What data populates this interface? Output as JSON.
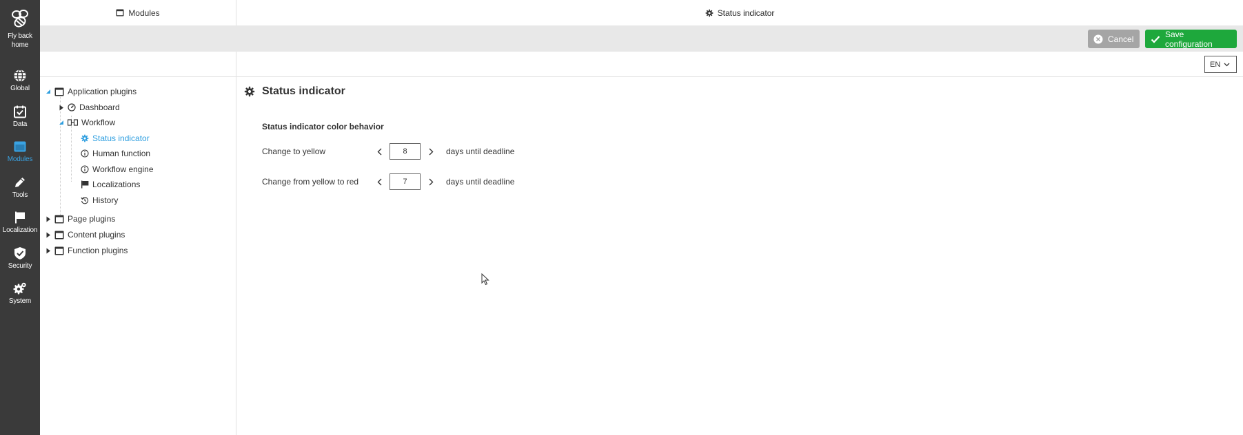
{
  "rail": {
    "home_label": "Fly back home",
    "items": [
      {
        "label": "Global",
        "icon": "globe-icon"
      },
      {
        "label": "Data",
        "icon": "calendar-check-icon"
      },
      {
        "label": "Modules",
        "icon": "window-icon",
        "active": true
      },
      {
        "label": "Tools",
        "icon": "pencil-icon"
      },
      {
        "label": "Localization",
        "icon": "flag-icon"
      },
      {
        "label": "Security",
        "icon": "shield-check-icon"
      },
      {
        "label": "System",
        "icon": "gears-icon"
      }
    ]
  },
  "header": {
    "left_title": "Modules",
    "right_title": "Status indicator"
  },
  "toolbar": {
    "cancel_label": "Cancel",
    "save_label": "Save configuration"
  },
  "language": {
    "selected": "EN"
  },
  "tree": {
    "items": [
      {
        "label": "Application plugins",
        "icon": "window-icon",
        "expanded": true
      },
      {
        "label": "Dashboard",
        "icon": "gauge-icon"
      },
      {
        "label": "Workflow",
        "icon": "workflow-icon",
        "expanded": true
      },
      {
        "label": "Status indicator",
        "icon": "gear-icon",
        "selected": true
      },
      {
        "label": "Human function",
        "icon": "info-icon"
      },
      {
        "label": "Workflow engine",
        "icon": "info-icon"
      },
      {
        "label": "Localizations",
        "icon": "flag-icon"
      },
      {
        "label": "History",
        "icon": "history-icon"
      },
      {
        "label": "Page plugins",
        "icon": "window-icon"
      },
      {
        "label": "Content plugins",
        "icon": "window-icon"
      },
      {
        "label": "Function plugins",
        "icon": "window-icon"
      }
    ]
  },
  "main": {
    "title": "Status indicator",
    "section_title": "Status indicator color behavior",
    "fields": [
      {
        "label": "Change to yellow",
        "value": "8",
        "suffix": "days until deadline"
      },
      {
        "label": "Change from yellow to red",
        "value": "7",
        "suffix": "days until deadline"
      }
    ]
  },
  "colors": {
    "rail_bg": "#3a3a3a",
    "accent": "#3aa3e3",
    "save_green": "#1ea83c",
    "cancel_gray": "#a5a5a5",
    "toolbar_bg": "#e8e8e8"
  }
}
